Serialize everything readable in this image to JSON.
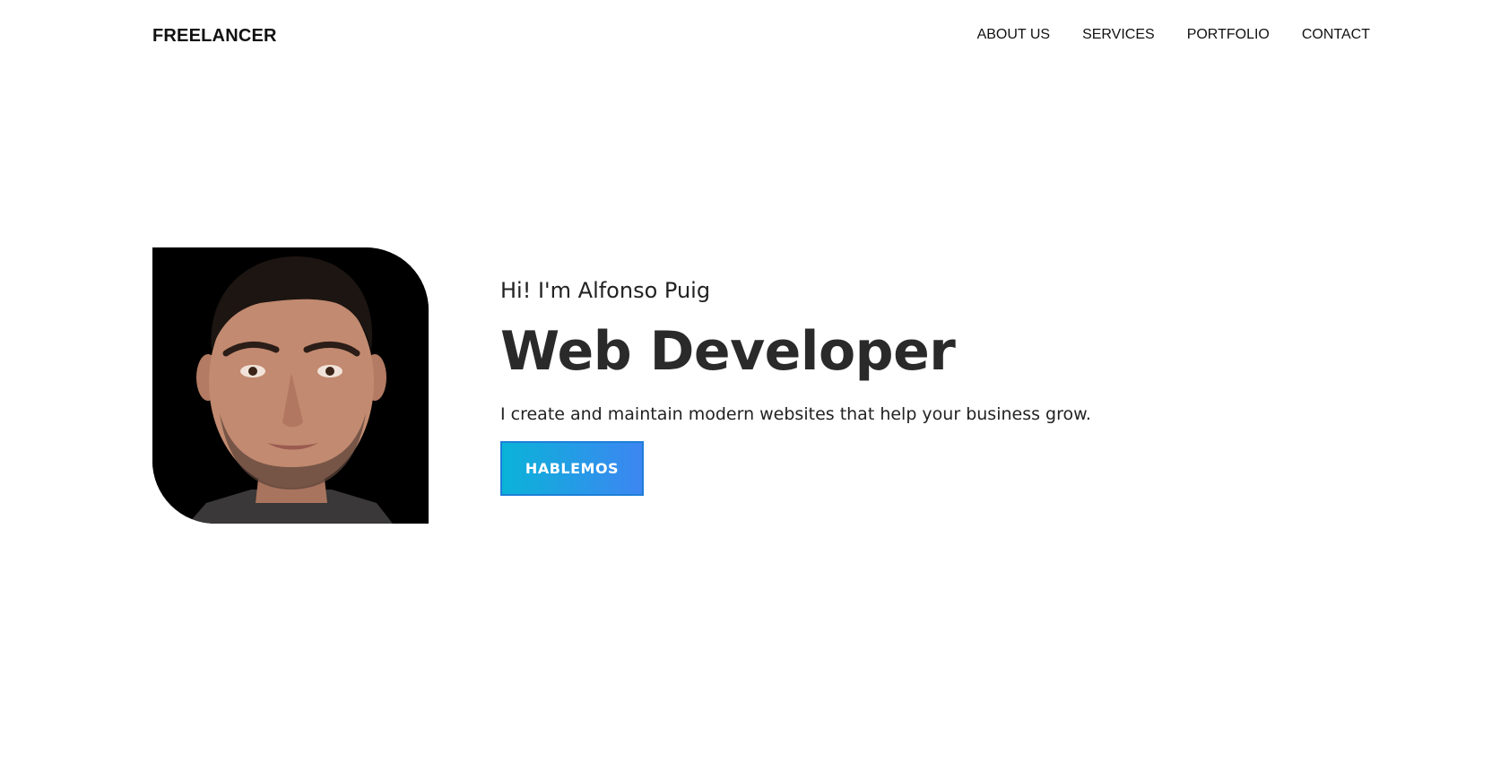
{
  "header": {
    "logo": "FREELANCER",
    "nav": [
      {
        "label": "ABOUT US"
      },
      {
        "label": "SERVICES"
      },
      {
        "label": "PORTFOLIO"
      },
      {
        "label": "CONTACT"
      }
    ]
  },
  "hero": {
    "greeting": "Hi! I'm Alfonso Puig",
    "headline": "Web Developer",
    "tagline": "I create and maintain modern websites that help your business grow.",
    "cta_label": "HABLEMOS",
    "avatar_icon": "portrait-photo"
  },
  "colors": {
    "accent_start": "#0ab3d8",
    "accent_end": "#3d86f2",
    "text": "#222222"
  }
}
